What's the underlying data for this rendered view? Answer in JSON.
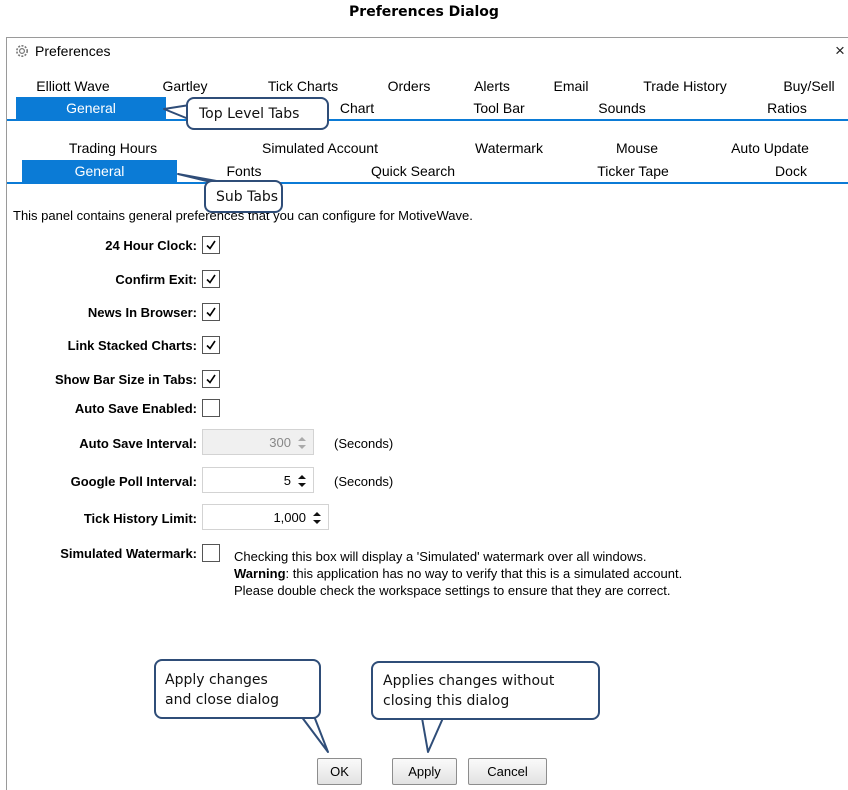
{
  "caption": "Preferences Dialog",
  "window": {
    "title": "Preferences",
    "close_glyph": "×",
    "icon": "gear-icon"
  },
  "top_tabs": {
    "row1": [
      "Elliott Wave",
      "Gartley",
      "Tick Charts",
      "Orders",
      "Alerts",
      "Email",
      "Trade History",
      "Buy/Sell"
    ],
    "row2": [
      "General",
      "Chart",
      "Tool Bar",
      "Sounds",
      "Ratios"
    ],
    "selected": "General"
  },
  "sub_tabs": {
    "row1": [
      "Trading Hours",
      "Simulated Account",
      "Watermark",
      "Mouse",
      "Auto Update"
    ],
    "row2": [
      "General",
      "Fonts",
      "Quick Search",
      "Ticker Tape",
      "Dock"
    ],
    "selected": "General"
  },
  "panel": {
    "description": "This panel contains general preferences that you can configure for MotiveWave.",
    "settings": [
      {
        "label": "24 Hour Clock:",
        "checked": true
      },
      {
        "label": "Confirm Exit:",
        "checked": true
      },
      {
        "label": "News In Browser:",
        "checked": true
      },
      {
        "label": "Link Stacked Charts:",
        "checked": true
      },
      {
        "label": "Show Bar Size in Tabs:",
        "checked": true
      },
      {
        "label": "Auto Save Enabled:",
        "checked": false
      }
    ],
    "auto_save_interval": {
      "label": "Auto Save Interval:",
      "value": "300",
      "unit": "(Seconds)",
      "disabled": true
    },
    "google_poll_interval": {
      "label": "Google Poll Interval:",
      "value": "5",
      "unit": "(Seconds)"
    },
    "tick_history_limit": {
      "label": "Tick History Limit:",
      "value": "1,000"
    },
    "simulated_watermark": {
      "label": "Simulated Watermark:",
      "checked": false,
      "line1": "Checking this box will display a 'Simulated' watermark over all windows.",
      "warning_label": "Warning",
      "line2": ": this application has no way to verify that this is a simulated account.",
      "line3": "Please double check the workspace settings to ensure that they are correct."
    }
  },
  "buttons": {
    "ok": "OK",
    "apply": "Apply",
    "cancel": "Cancel"
  },
  "callouts": {
    "top_level_tabs": "Top Level Tabs",
    "sub_tabs": "Sub Tabs",
    "ok_line1": "Apply changes",
    "ok_line2": "and close dialog",
    "apply_line1": "Applies changes without",
    "apply_line2": "closing this dialog"
  },
  "colors": {
    "accent": "#0b7bd6",
    "callout_border": "#2f4d78"
  }
}
